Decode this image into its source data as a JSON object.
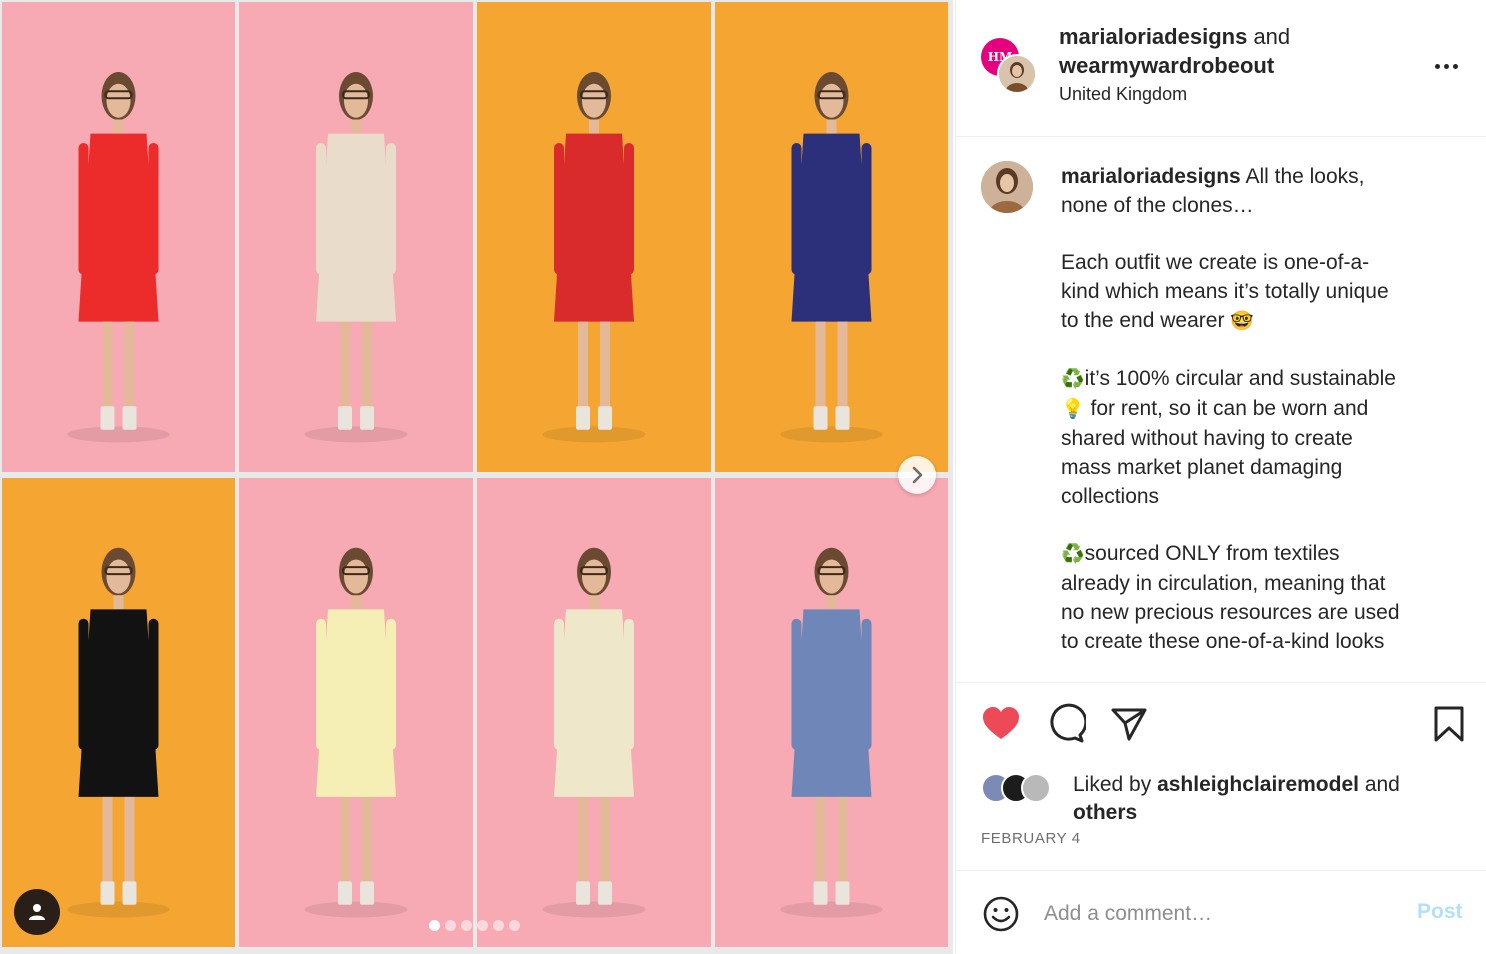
{
  "header": {
    "username_primary": "marialoriadesigns",
    "and_word": "and",
    "username_secondary": "wearmywardrobeout",
    "location": "United Kingdom",
    "avatar_initials": "HM"
  },
  "caption": {
    "username": "marialoriadesigns",
    "line1": "All the looks,",
    "line2": "none of the clones…",
    "para2_l1": "Each outfit we create is one-of-a-",
    "para2_l2": "kind which means it’s totally unique",
    "para2_l3": "to the end wearer",
    "para2_emoji": "🤓",
    "para3_emoji": "♻️",
    "para3_l1": "it’s 100% circular and sustainable",
    "para3_emoji2": "💡",
    "para3_l2": "for rent, so it can be worn and",
    "para3_l3": "shared without having to create",
    "para3_l4": "mass market planet damaging",
    "para3_l5": "collections",
    "para4_emoji": "♻️",
    "para4_l1": "sourced ONLY from textiles",
    "para4_l2": "already in circulation, meaning that",
    "para4_l3": "no new precious resources are used",
    "para4_l4": "to create these one-of-a-kind looks"
  },
  "likes": {
    "prefix": "Liked by",
    "user": "ashleighclairemodel",
    "and_word": "and",
    "others": "others"
  },
  "date": "FEBRUARY 4",
  "comment": {
    "placeholder": "Add a comment…",
    "post_label": "Post"
  },
  "media": {
    "backgrounds": [
      "#f7a9b4",
      "#f7a9b4",
      "#f5a531",
      "#f5a531",
      "#f5a531",
      "#f7a9b4",
      "#f7a9b4",
      "#f7a9b4"
    ],
    "outfit_colors": [
      "#ec2b2b",
      "#eadccb",
      "#d92b2b",
      "#2c2f7a",
      "#121212",
      "#f5eeb5",
      "#efe7c9",
      "#6f86b8"
    ],
    "carousel_dots": 6,
    "active_dot": 1
  },
  "icons": [
    "heart-icon",
    "comment-icon",
    "share-icon",
    "bookmark-icon",
    "emoji-icon",
    "chevron-right-icon",
    "user-tag-icon",
    "more-icon"
  ],
  "colors": {
    "like_red": "#ed4956",
    "post_blue_disabled": "#b2dffc",
    "text_primary": "#262626",
    "text_secondary": "#8e8e8e"
  }
}
